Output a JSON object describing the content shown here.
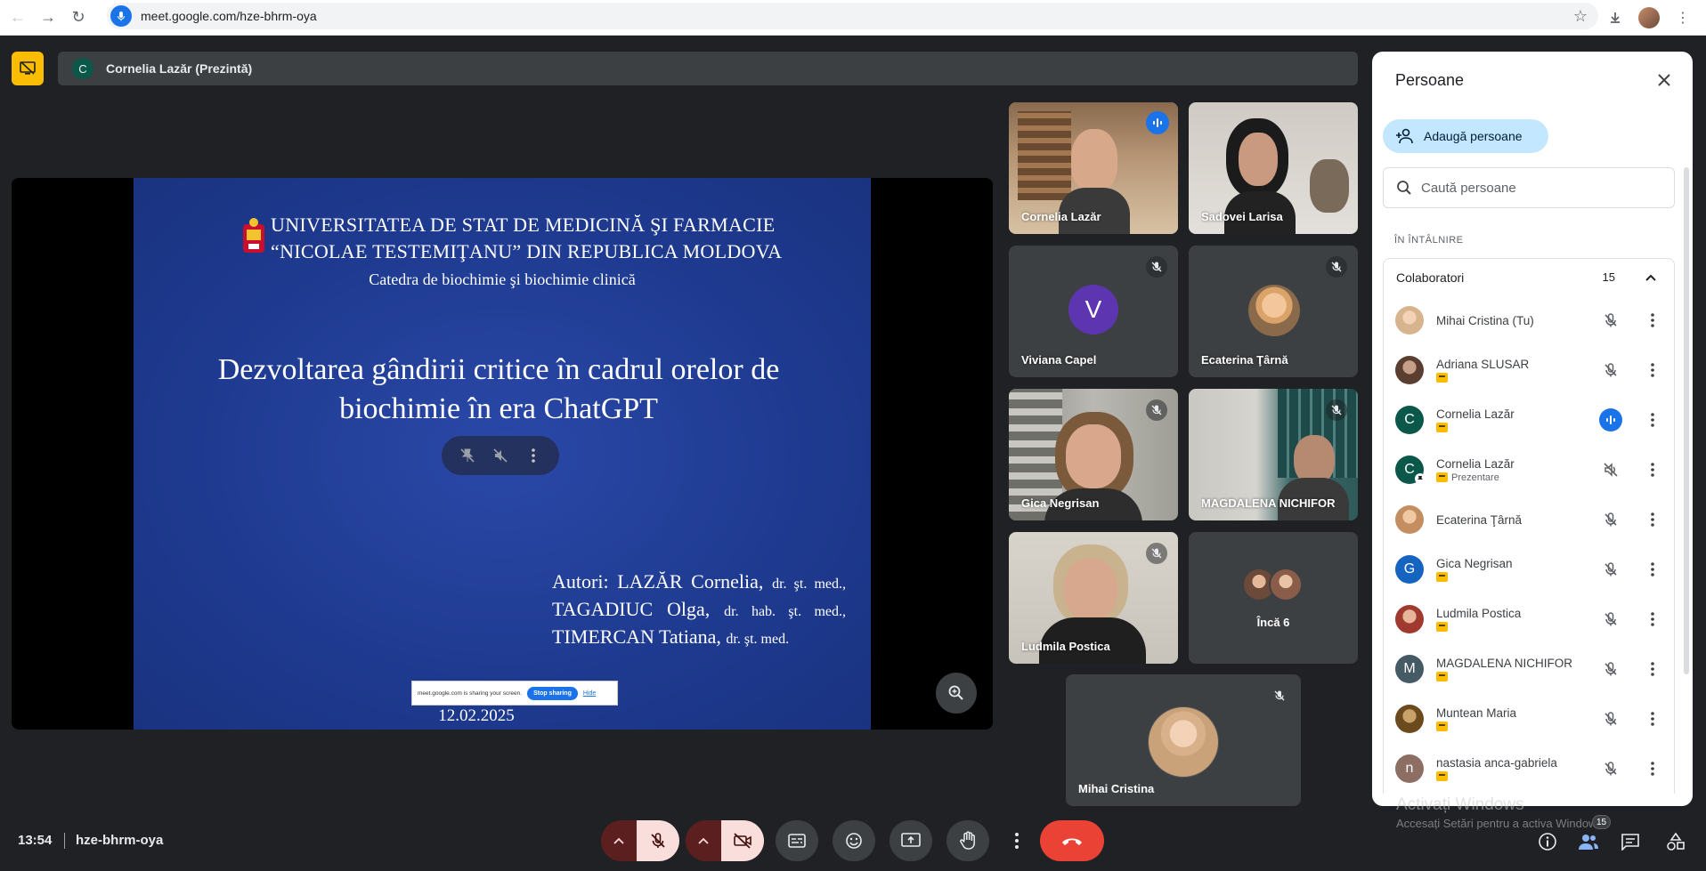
{
  "browser": {
    "url_host": "meet.google.com",
    "url_path": "/hze-bhrm-oya"
  },
  "banner": {
    "presenter_initial": "C",
    "presenter_label": "Cornelia Lazăr (Prezintă)"
  },
  "slide": {
    "university_line1": "UNIVERSITATEA DE STAT DE MEDICINĂ ŞI FARMACIE",
    "university_line2": "“NICOLAE TESTEMIŢANU” DIN REPUBLICA MOLDOVA",
    "department": "Catedra de biochimie şi biochimie clinică",
    "title_line1": "Dezvoltarea gândirii critice în cadrul orelor de",
    "title_line2": "biochimie în era ChatGPT",
    "authors_label": "Autori:",
    "author1": "LAZĂR Cornelia,",
    "author1_deg": "dr. şt. med.,",
    "author2": "TAGADIUC Olga,",
    "author2_deg": "dr. hab. şt. med.,",
    "author3": "TIMERCAN Tatiana,",
    "author3_deg": "dr. şt. med.",
    "date": "12.02.2025",
    "share_notice_text": "meet.google.com is sharing your screen.",
    "share_stop": "Stop sharing",
    "share_hide": "Hide"
  },
  "tiles": {
    "t1": "Cornelia Lazăr",
    "t2": "Sadovei Larisa",
    "t3": "Viviana Capel",
    "t3_initial": "V",
    "t4": "Ecaterina Ţârnă",
    "t5": "Gica Negrisan",
    "t6": "MAGDALENA NICHIFOR",
    "t7": "Ludmila Postica",
    "t8": "Încă 6",
    "self": "Mihai Cristina"
  },
  "panel": {
    "title": "Persoane",
    "add_button": "Adaugă persoane",
    "search_placeholder": "Caută persoane",
    "section": "ÎN ÎNTÂLNIRE",
    "group_name": "Colaboratori",
    "group_count": "15",
    "participants": [
      {
        "name": "Mihai Cristina (Tu)",
        "sub": "",
        "initial": ""
      },
      {
        "name": "Adriana SLUSAR",
        "sub": "",
        "initial": ""
      },
      {
        "name": "Cornelia Lazăr",
        "sub": "",
        "initial": "C"
      },
      {
        "name": "Cornelia Lazăr",
        "sub": "Prezentare",
        "initial": "C"
      },
      {
        "name": "Ecaterina Ţârnă",
        "sub": "",
        "initial": ""
      },
      {
        "name": "Gica Negrisan",
        "sub": "",
        "initial": "G"
      },
      {
        "name": "Ludmila Postica",
        "sub": "",
        "initial": ""
      },
      {
        "name": "MAGDALENA NICHIFOR",
        "sub": "",
        "initial": "M"
      },
      {
        "name": "Muntean Maria",
        "sub": "",
        "initial": ""
      },
      {
        "name": "nastasia anca-gabriela",
        "sub": "",
        "initial": "n"
      }
    ]
  },
  "bottom": {
    "time": "13:54",
    "meeting_code": "hze-bhrm-oya",
    "people_count": "15"
  },
  "watermark": {
    "line1": "Activați Windows",
    "line2": "Accesați Setări pentru a activa Windows."
  },
  "colors": {
    "accent_blue": "#1a73e8",
    "end_call_red": "#ea4335",
    "present_yellow": "#fbbc04"
  }
}
